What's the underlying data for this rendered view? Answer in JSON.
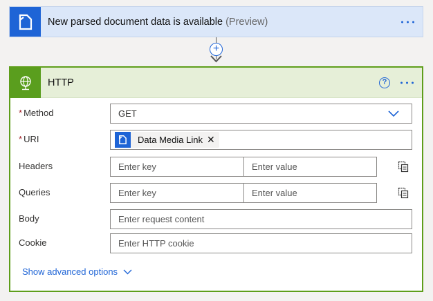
{
  "trigger": {
    "title": "New parsed document data is available",
    "preview": "(Preview)",
    "icon": "document-link-icon"
  },
  "connector": {
    "plus": "+"
  },
  "http": {
    "title": "HTTP",
    "icon": "globe-icon",
    "help": "?",
    "fields": {
      "method": {
        "label": "Method",
        "required": "*",
        "value": "GET"
      },
      "uri": {
        "label": "URI",
        "required": "*",
        "token": "Data Media Link",
        "token_close": "✕"
      },
      "headers": {
        "label": "Headers",
        "key_placeholder": "Enter key",
        "value_placeholder": "Enter value"
      },
      "queries": {
        "label": "Queries",
        "key_placeholder": "Enter key",
        "value_placeholder": "Enter value"
      },
      "body": {
        "label": "Body",
        "placeholder": "Enter request content"
      },
      "cookie": {
        "label": "Cookie",
        "placeholder": "Enter HTTP cookie"
      }
    },
    "advanced_label": "Show advanced options"
  },
  "colors": {
    "accent_blue": "#1e64d6",
    "http_green": "#5a9e1e",
    "trigger_bg": "#dbe7f9",
    "http_header_bg": "#e6efd8"
  }
}
